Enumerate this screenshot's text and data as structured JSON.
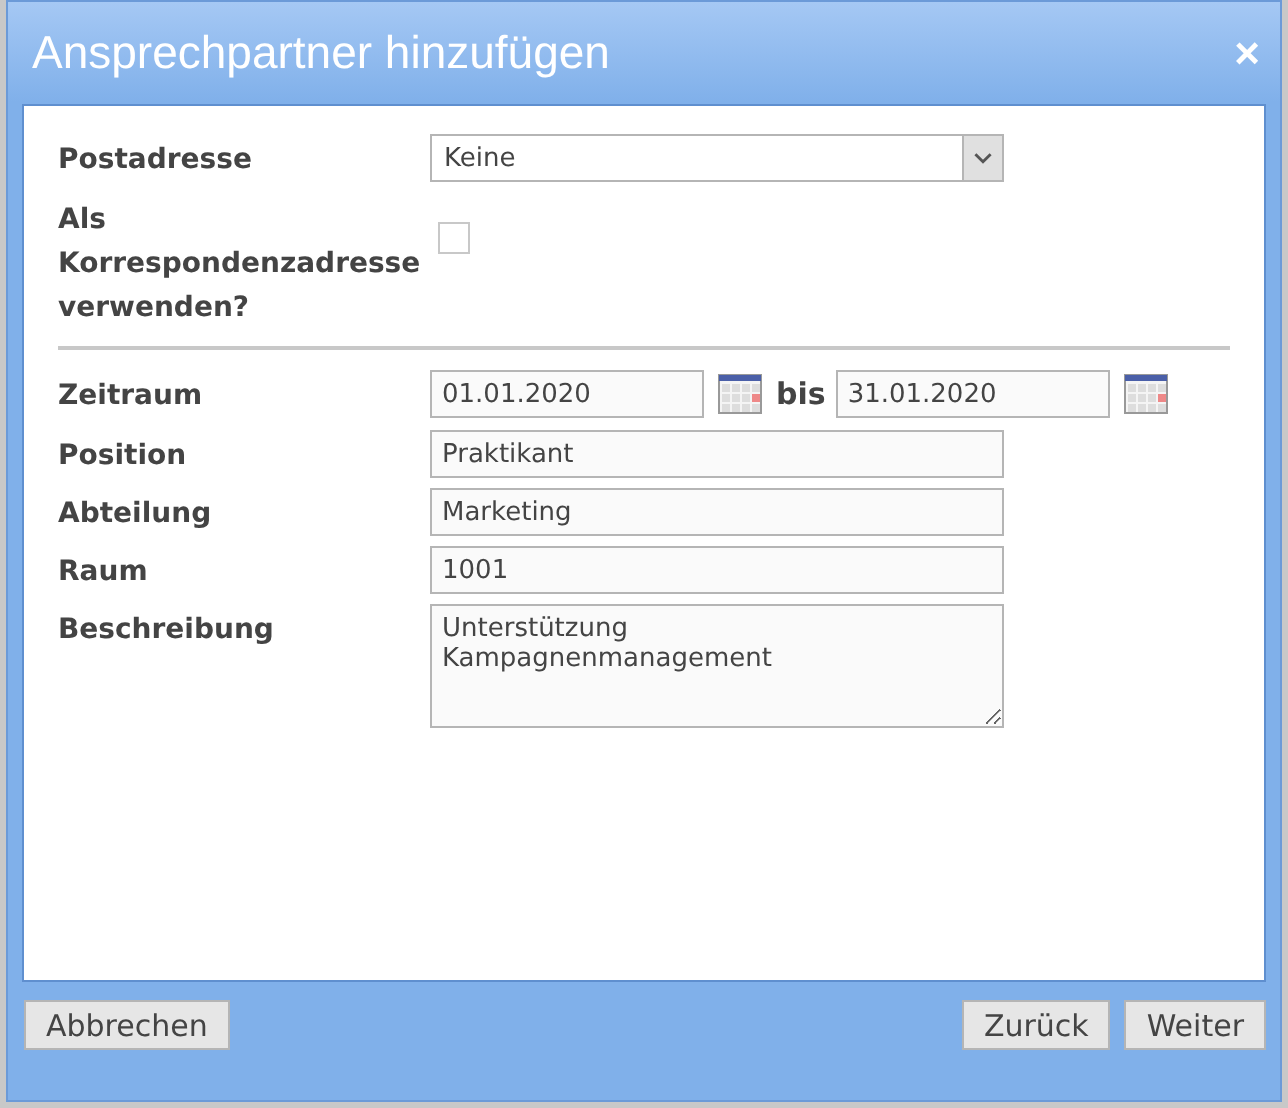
{
  "dialog": {
    "title": "Ansprechpartner hinzufügen",
    "close": "×"
  },
  "postal_address": {
    "label": "Postadresse",
    "value": "Keine"
  },
  "correspondence": {
    "label": "Als Korrespondenzadresse verwenden?",
    "checked": false
  },
  "period": {
    "label": "Zeitraum",
    "from": "01.01.2020",
    "separator": "bis",
    "to": "31.01.2020"
  },
  "fields": [
    {
      "label": "Position",
      "value": "Praktikant"
    },
    {
      "label": "Abteilung",
      "value": "Marketing"
    },
    {
      "label": "Raum",
      "value": "1001"
    }
  ],
  "description": {
    "label": "Beschreibung",
    "value": "Unterstützung\nKampagnenmanagement"
  },
  "buttons": {
    "left": [
      "Abbrechen"
    ],
    "right": [
      "Zurück",
      "Weiter"
    ]
  }
}
